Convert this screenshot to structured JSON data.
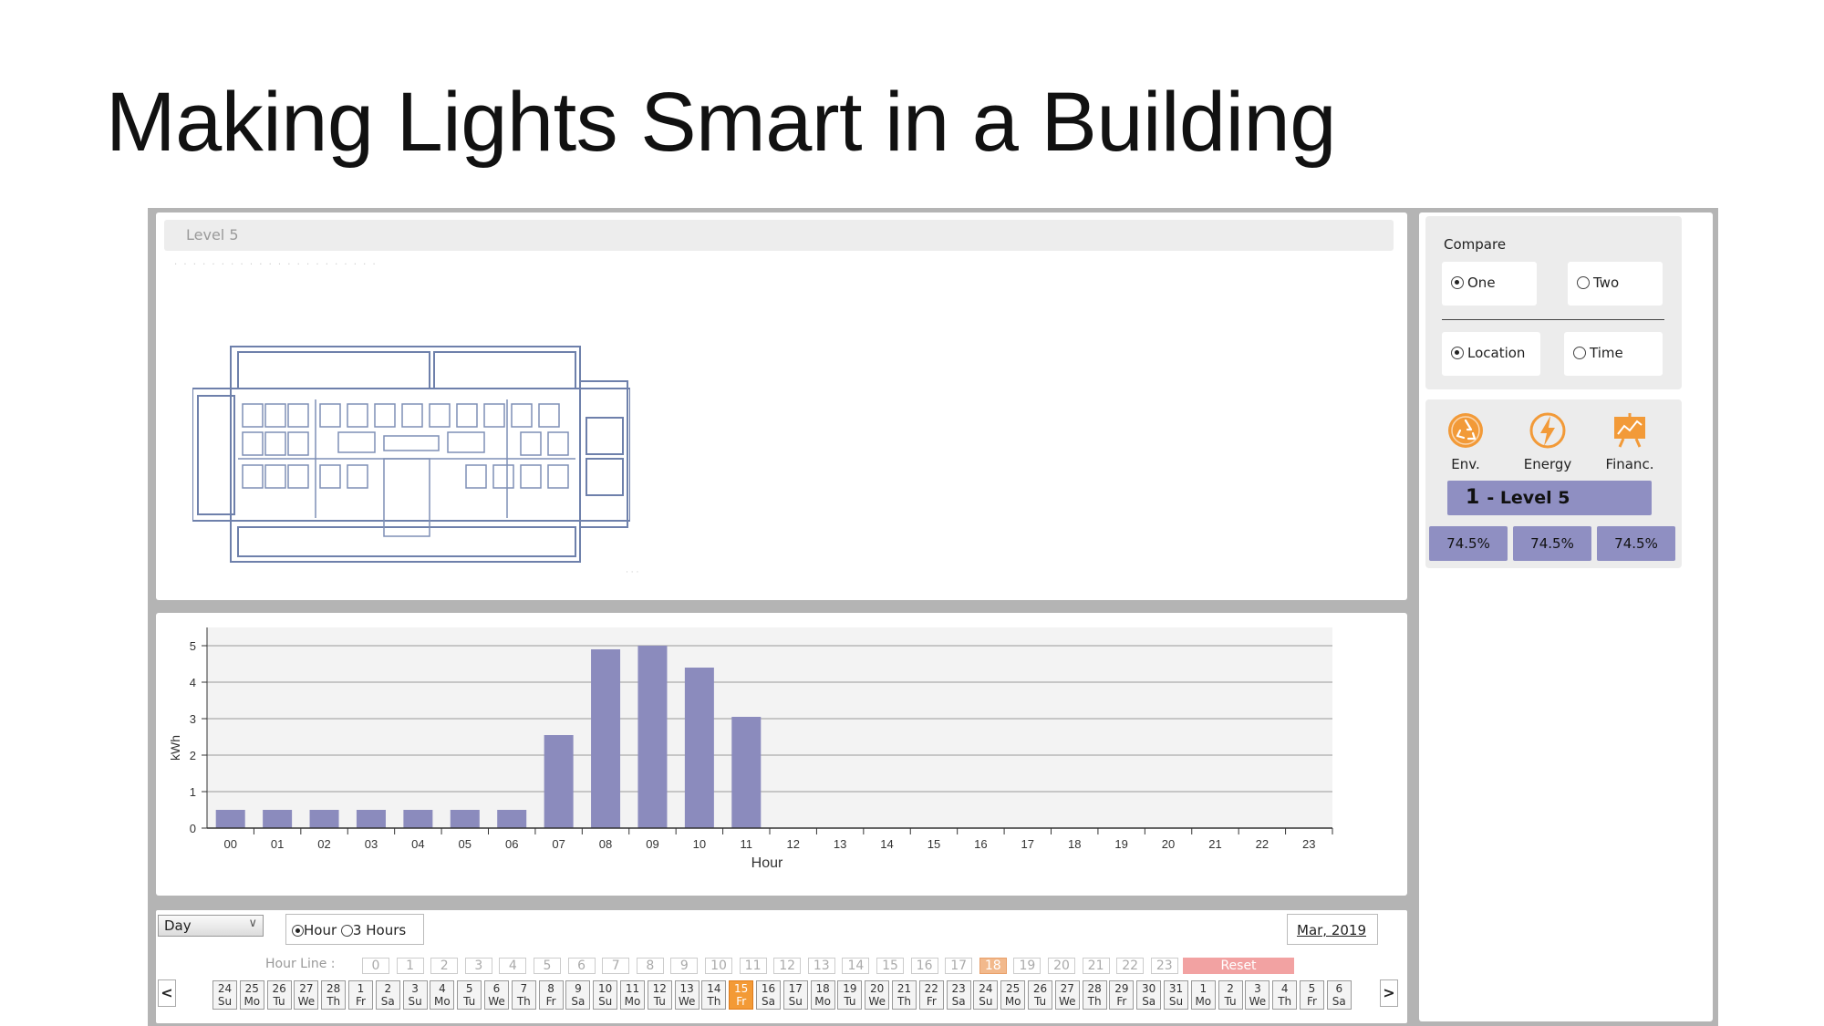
{
  "slide": {
    "title": "Making Lights Smart in a Building"
  },
  "plan": {
    "level_label": "Level 5"
  },
  "chart_data": {
    "type": "bar",
    "categories": [
      "00",
      "01",
      "02",
      "03",
      "04",
      "05",
      "06",
      "07",
      "08",
      "09",
      "10",
      "11",
      "12",
      "13",
      "14",
      "15",
      "16",
      "17",
      "18",
      "19",
      "20",
      "21",
      "22",
      "23"
    ],
    "values": [
      0.5,
      0.5,
      0.5,
      0.5,
      0.5,
      0.5,
      0.5,
      2.55,
      4.9,
      5.0,
      4.4,
      3.05,
      0,
      0,
      0,
      0,
      0,
      0,
      0,
      0,
      0,
      0,
      0,
      0
    ],
    "xlabel": "Hour",
    "ylabel": "kWh",
    "ylim": [
      0,
      5.5
    ],
    "yticks": [
      0,
      1,
      2,
      3,
      4,
      5
    ],
    "grid": true,
    "bar_color": "#8b8bbd"
  },
  "controls": {
    "period_select": "Day",
    "granularity": {
      "hour": "Hour",
      "three_hours": "3 Hours",
      "selected": "Hour"
    },
    "month_button": "Mar, 2019",
    "hour_line_label": "Hour Line :",
    "hour_cells": [
      "0",
      "1",
      "2",
      "3",
      "4",
      "5",
      "6",
      "7",
      "8",
      "9",
      "10",
      "11",
      "12",
      "13",
      "14",
      "15",
      "16",
      "17",
      "18",
      "19",
      "20",
      "21",
      "22",
      "23"
    ],
    "highlighted_hour": "18",
    "reset_label": "Reset",
    "prev_arrow": "<",
    "next_arrow": ">",
    "dates": [
      {
        "d": "24",
        "w": "Su"
      },
      {
        "d": "25",
        "w": "Mo"
      },
      {
        "d": "26",
        "w": "Tu"
      },
      {
        "d": "27",
        "w": "We"
      },
      {
        "d": "28",
        "w": "Th"
      },
      {
        "d": "1",
        "w": "Fr"
      },
      {
        "d": "2",
        "w": "Sa"
      },
      {
        "d": "3",
        "w": "Su"
      },
      {
        "d": "4",
        "w": "Mo"
      },
      {
        "d": "5",
        "w": "Tu"
      },
      {
        "d": "6",
        "w": "We"
      },
      {
        "d": "7",
        "w": "Th"
      },
      {
        "d": "8",
        "w": "Fr"
      },
      {
        "d": "9",
        "w": "Sa"
      },
      {
        "d": "10",
        "w": "Su"
      },
      {
        "d": "11",
        "w": "Mo"
      },
      {
        "d": "12",
        "w": "Tu"
      },
      {
        "d": "13",
        "w": "We"
      },
      {
        "d": "14",
        "w": "Th"
      },
      {
        "d": "15",
        "w": "Fr"
      },
      {
        "d": "16",
        "w": "Sa"
      },
      {
        "d": "17",
        "w": "Su"
      },
      {
        "d": "18",
        "w": "Mo"
      },
      {
        "d": "19",
        "w": "Tu"
      },
      {
        "d": "20",
        "w": "We"
      },
      {
        "d": "21",
        "w": "Th"
      },
      {
        "d": "22",
        "w": "Fr"
      },
      {
        "d": "23",
        "w": "Sa"
      },
      {
        "d": "24",
        "w": "Su"
      },
      {
        "d": "25",
        "w": "Mo"
      },
      {
        "d": "26",
        "w": "Tu"
      },
      {
        "d": "27",
        "w": "We"
      },
      {
        "d": "28",
        "w": "Th"
      },
      {
        "d": "29",
        "w": "Fr"
      },
      {
        "d": "30",
        "w": "Sa"
      },
      {
        "d": "31",
        "w": "Su"
      },
      {
        "d": "1",
        "w": "Mo"
      },
      {
        "d": "2",
        "w": "Tu"
      },
      {
        "d": "3",
        "w": "We"
      },
      {
        "d": "4",
        "w": "Th"
      },
      {
        "d": "5",
        "w": "Fr"
      },
      {
        "d": "6",
        "w": "Sa"
      }
    ],
    "selected_date_index": 19
  },
  "side": {
    "compare_label": "Compare",
    "opt_one": "One",
    "opt_two": "Two",
    "opt_location": "Location",
    "opt_time": "Time",
    "metrics": [
      {
        "label": "Env.",
        "icon": "recycle-icon"
      },
      {
        "label": "Energy",
        "icon": "lightning-icon"
      },
      {
        "label": "Financ.",
        "icon": "chart-board-icon"
      }
    ],
    "level_number": "1",
    "level_name": "- Level 5",
    "percentages": [
      "74.5%",
      "74.5%",
      "74.5%"
    ],
    "accent_color": "#8f8fc2",
    "icon_color": "#f29a38"
  }
}
